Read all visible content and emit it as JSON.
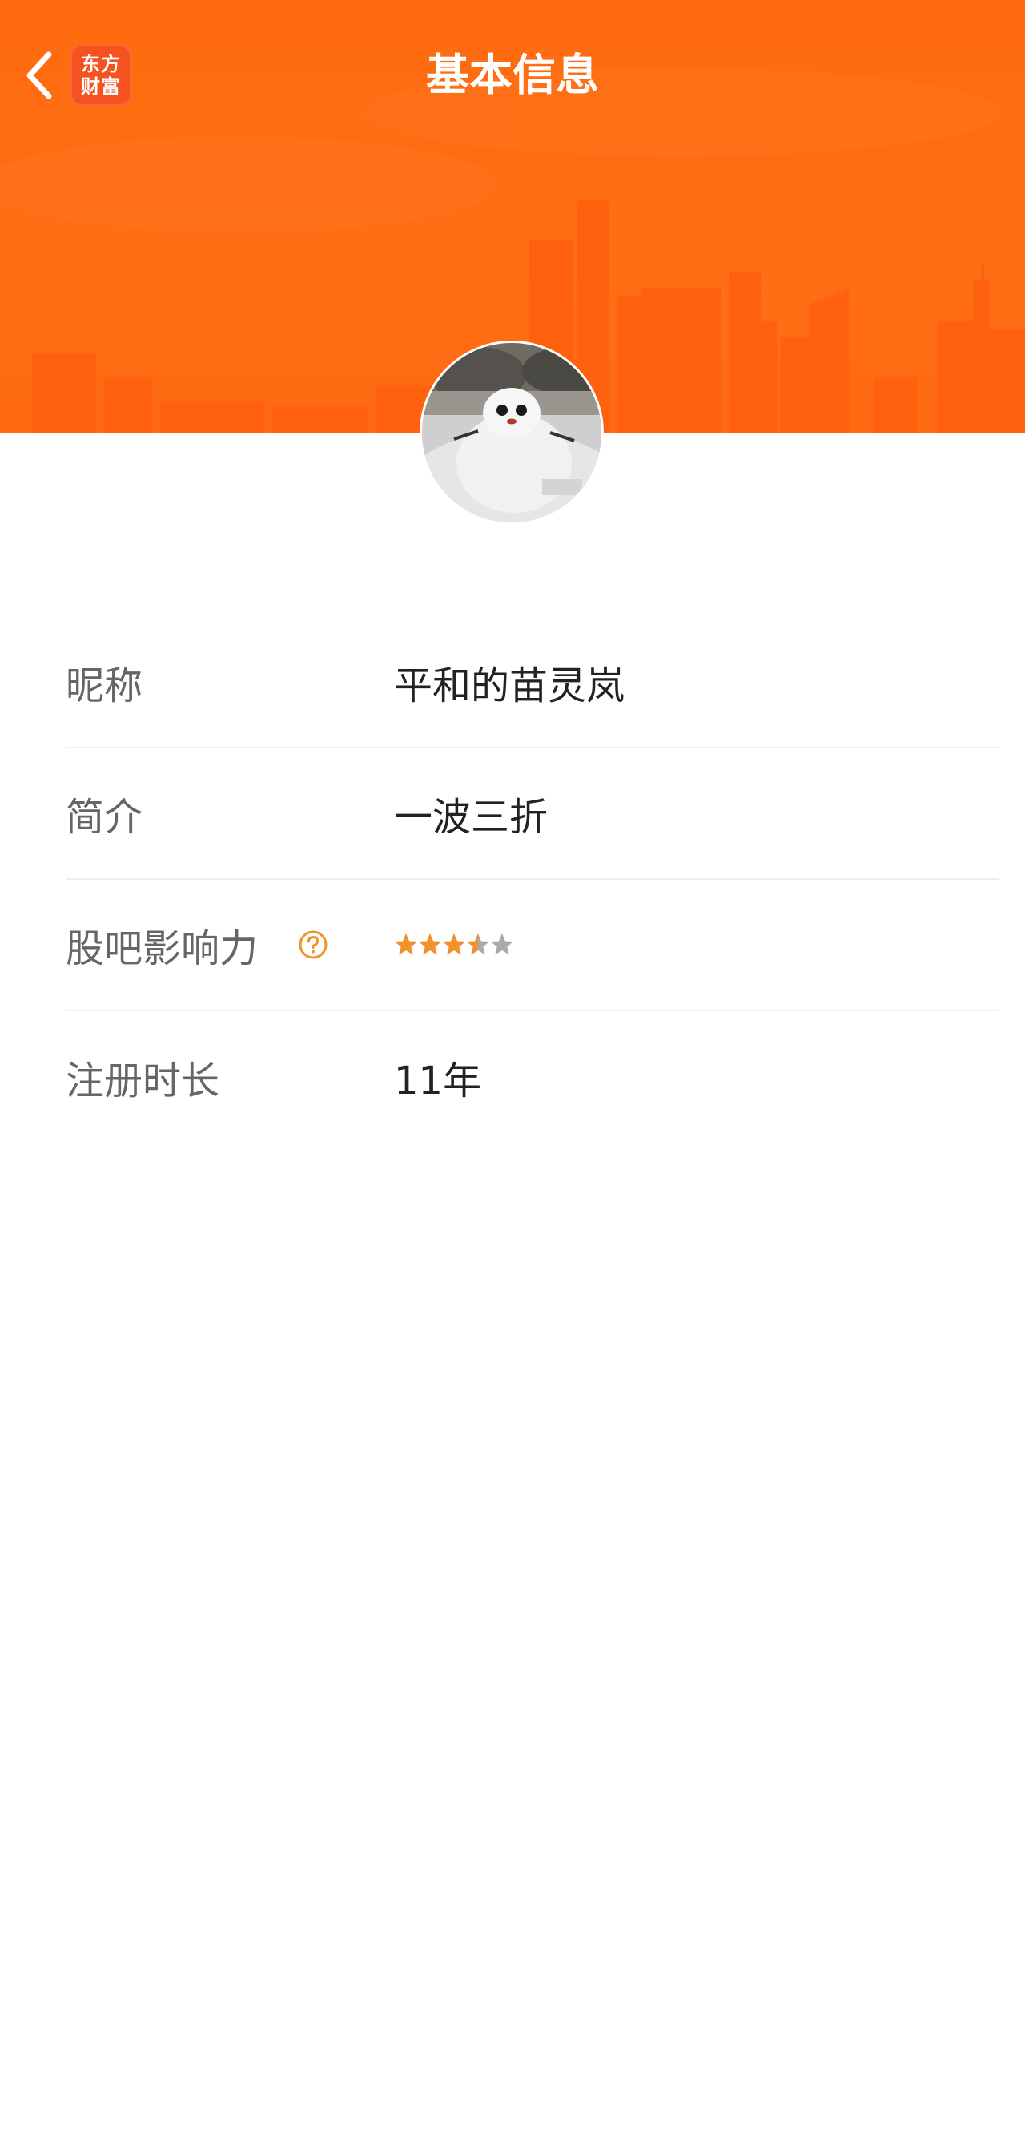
{
  "header": {
    "title": "基本信息",
    "logo_line1": "东方",
    "logo_line2": "财富",
    "background_color": "#ff6a10",
    "logo_color": "#f4521e"
  },
  "icons": {
    "back": "chevron-left-icon",
    "help": "question-circle-icon",
    "star": "star-icon"
  },
  "profile": {
    "avatar": "snowman-photo",
    "rows": [
      {
        "label": "昵称",
        "value": "平和的苗灵岚"
      },
      {
        "label": "简介",
        "value": "一波三折"
      },
      {
        "label": "股吧影响力",
        "rating": 3.5,
        "rating_max": 5,
        "star_color": "#f0922b",
        "star_empty_color": "#aaaaaa"
      },
      {
        "label": "注册时长",
        "value": "11年"
      }
    ]
  }
}
